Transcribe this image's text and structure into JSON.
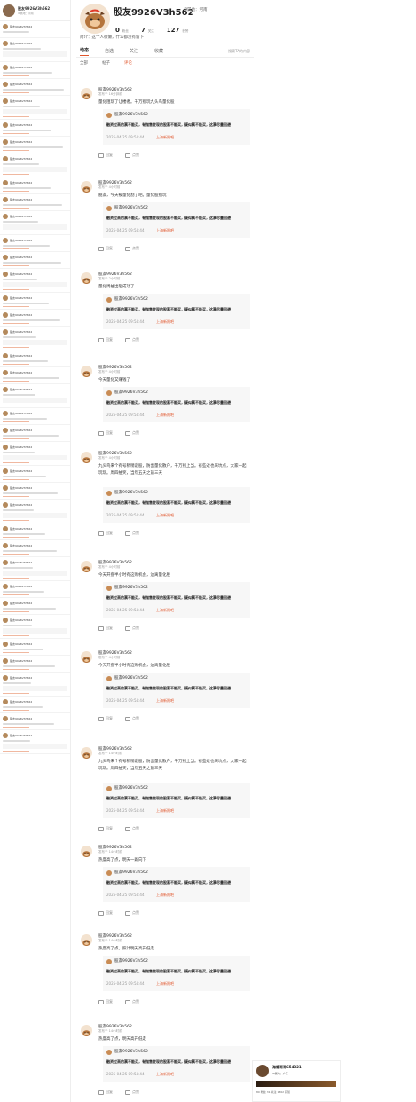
{
  "profile": {
    "nickname": "股友9926V3h562",
    "ip_location": "IP属地：河南",
    "stats": [
      {
        "value": "0",
        "label": "粉丝"
      },
      {
        "value": "7",
        "label": "关注"
      },
      {
        "value": "127",
        "label": "获赞"
      }
    ],
    "bio": "简介：这个人很懒，什么都没有留下",
    "tabs": [
      "动态",
      "自选",
      "关注",
      "收藏"
    ],
    "active_tab": "动态",
    "search_label": "搜索TA的内容",
    "subtabs": [
      "全部",
      "帖子",
      "评论"
    ],
    "active_subtab": "评论"
  },
  "quote": {
    "author": "股友9926V3h562",
    "text": "融资过高的票不能买，有抛售变现的股票不能买，疑似票不能买，这票尽量回避",
    "time": "2025-04-25 09:54:44",
    "source": "上海新阳吧"
  },
  "actions": {
    "reply": "回复",
    "like": "点赞"
  },
  "posts": [
    {
      "name": "股友9926V3h562",
      "meta": "发布于 16分钟前",
      "text": "量化阻玩了让楼者。千万别玩九头鸟量化股"
    },
    {
      "name": "股友9926V3h562",
      "meta": "发布于 4小时前",
      "text": "朋友，今天被量化割了吧。量化股别玩"
    },
    {
      "name": "股友9926V3h562",
      "meta": "发布于 2小时前",
      "text": "量化周抽出阻成功了"
    },
    {
      "name": "股友9926V3h562",
      "meta": "发布于 4小时前",
      "text": "今天量化又赚钱了"
    },
    {
      "name": "股友9926V3h562",
      "meta": "发布于 4小时前",
      "text": "九头鸟来个有号稍稍说股，防出量化散户，千万别上当。有些过也来坑点，大家一起玩玩。周四抽奖，当然五天之前三天"
    },
    {
      "name": "股友9926V3h562",
      "meta": "发布于 4小时前",
      "text": "今天开盘半小时有这购机会，边离量化股"
    },
    {
      "name": "股友9926V3h562",
      "meta": "发布于 4小时前",
      "text": "今天开盘半小时有这购机会，边离量化股"
    },
    {
      "name": "股友9926V3h562",
      "meta": "发布于 14小时前",
      "text": "九头鸟来个有号稍稍说股，防出量化散户，千万别上当。有些过也来坑点，大家一起玩玩。周四抽奖，当然五天之前三天"
    },
    {
      "name": "股友9926V3h562",
      "meta": "发布于 14小时前",
      "text": "热度高了点，明天一路向下"
    },
    {
      "name": "股友9926V3h562",
      "meta": "发布于 14小时前",
      "text": "热度高了点，照计明天高开低走"
    },
    {
      "name": "股友9926V3h562",
      "meta": "发布于 14小时前",
      "text": "热度高了点，明天高开低走"
    }
  ],
  "left_column": {
    "user": "股友9926V3h562",
    "sub": "IP属地：河南",
    "item_name": "股友9926V3h562"
  },
  "card": {
    "name": "海螺哥哥654321",
    "sub": "IP属地：广东",
    "stats": "80 粉丝   31 关注   1362 获赞",
    "tabs": "动态   自选   关注   收藏"
  }
}
